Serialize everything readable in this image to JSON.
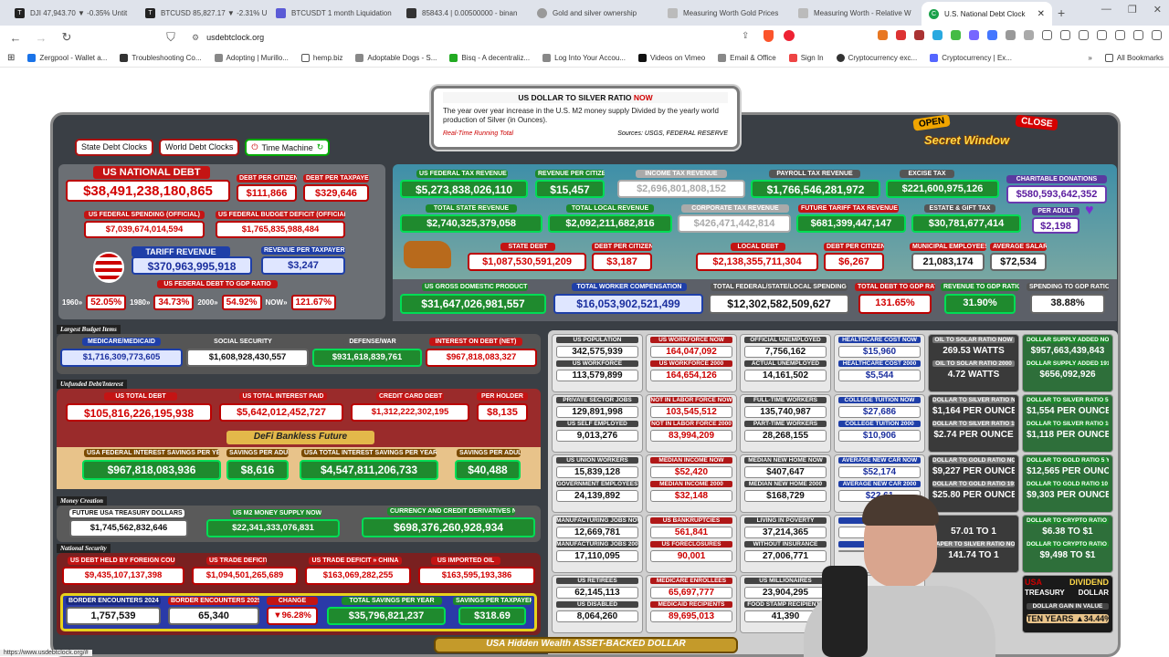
{
  "tabs": [
    {
      "label": "DJI 47,943.70 ▼ -0.35% Untit",
      "color": "#222"
    },
    {
      "label": "BTCUSD 85,827.17 ▼ -2.31% U",
      "color": "#222"
    },
    {
      "label": "BTCUSDT 1 month Liquidation",
      "color": "#5b5bd6"
    },
    {
      "label": "85843.4 | 0.00500000 - binan",
      "color": "#222"
    },
    {
      "label": "Gold and silver ownership",
      "color": "#888"
    },
    {
      "label": "Measuring Worth Gold Prices",
      "color": "#888"
    },
    {
      "label": "Measuring Worth - Relative W",
      "color": "#888"
    },
    {
      "label": "U.S. National Debt Clock",
      "color": "#1aa14a"
    }
  ],
  "address": "usdebtclock.org",
  "bookmarks": [
    "Zergpool - Wallet a...",
    "Troubleshooting Co...",
    "Adopting | Murillo...",
    "hemp.biz",
    "Adoptable Dogs - S...",
    "Bisq - A decentraliz...",
    "Log Into Your Accou...",
    "Videos on Vimeo",
    "Email & Office",
    "Sign In",
    "Cryptocurrency exc...",
    "Cryptocurrency | Ex...",
    "All Bookmarks"
  ],
  "notice": {
    "title_prefix": "US DOLLAR TO SILVER RATIO ",
    "title_now": "NOW",
    "desc": "The year over year increase in the U.S. M2 money supply Divided by the yearly world production of Silver (in Ounces).",
    "left": "Real-Time Running Total",
    "right": "Sources: USGS, FEDERAL RESERVE"
  },
  "secret": {
    "open": "OPEN",
    "close": "CLOSE",
    "title": "Secret Window"
  },
  "buttons": {
    "state": "State Debt Clocks",
    "world": "World Debt Clocks",
    "time": "Time Machine"
  },
  "left_top": {
    "debt_label": "US NATIONAL DEBT",
    "debt": "$38,491,238,180,865",
    "dpc_label": "DEBT PER CITIZEN",
    "dpc": "$111,866",
    "dpt_label": "DEBT PER TAXPAYER",
    "dpt": "$329,646",
    "spend_label": "US FEDERAL SPENDING (OFFICIAL)",
    "spend": "$7,039,674,014,594",
    "deficit_label": "US FEDERAL BUDGET DEFICIT (OFFICIAL)",
    "deficit": "$1,765,835,988,484",
    "tariff_label": "TARIFF REVENUE",
    "tariff": "$370,963,995,918",
    "rpt_label": "REVENUE PER TAXPAYER",
    "rpt": "$3,247",
    "gdp_label": "US FEDERAL DEBT TO GDP RATIO",
    "gdp": [
      {
        "y": "1960»",
        "v": "52.05%"
      },
      {
        "y": "1980»",
        "v": "34.73%"
      },
      {
        "y": "2000»",
        "v": "54.92%"
      },
      {
        "y": "NOW»",
        "v": "121.67%"
      }
    ]
  },
  "revenue": {
    "fed_label": "US FEDERAL TAX REVENUE",
    "fed": "$5,273,838,026,110",
    "rpc_label": "REVENUE PER CITIZEN",
    "rpc": "$15,457",
    "inc_label": "INCOME TAX REVENUE",
    "inc": "$2,696,801,808,152",
    "pay_label": "PAYROLL TAX REVENUE",
    "pay": "$1,766,546,281,972",
    "exc_label": "EXCISE TAX",
    "exc": "$221,600,975,126",
    "char_label": "CHARITABLE DONATIONS",
    "char": "$580,593,642,352",
    "st_label": "TOTAL STATE REVENUE",
    "st": "$2,740,325,379,058",
    "loc_label": "TOTAL LOCAL REVENUE",
    "loc": "$2,092,211,682,816",
    "corp_label": "CORPORATE TAX REVENUE",
    "corp": "$426,471,442,814",
    "ft_label": "FUTURE TARIFF TAX REVENUE",
    "ft": "$681,399,447,147",
    "est_label": "ESTATE & GIFT TAX",
    "est": "$30,781,677,414",
    "pa_label": "PER ADULT",
    "pa": "$2,198",
    "sd_label": "STATE DEBT",
    "sd": "$1,087,530,591,209",
    "sdpc_label": "DEBT PER CITIZEN",
    "sdpc": "$3,187",
    "ld_label": "LOCAL DEBT",
    "ld": "$2,138,355,711,304",
    "ldpc_label": "DEBT PER CITIZEN",
    "ldpc": "$6,267",
    "me_label": "MUNICIPAL EMPLOYEES",
    "me": "21,083,174",
    "as_label": "AVERAGE SALARY",
    "as": "$72,534",
    "gdp_label": "US GROSS DOMESTIC PRODUCT",
    "gdp": "$31,647,026,981,557",
    "twc_label": "TOTAL WORKER COMPENSATION",
    "twc": "$16,053,902,521,499",
    "tfd_label": "TOTAL FEDERAL/STATE/LOCAL SPENDING",
    "tfd": "$12,302,582,509,627",
    "tdg_label": "TOTAL DEBT TO GDP RATIO",
    "tdg": "131.65%",
    "rg_label": "REVENUE TO GDP RATIO",
    "rg": "31.90%",
    "sg_label": "SPENDING TO GDP RATIO",
    "sg": "38.88%"
  },
  "budget": {
    "section": "Largest Budget Items",
    "items": [
      {
        "label": "MEDICARE/MEDICAID",
        "value": "$1,716,309,773,605"
      },
      {
        "label": "SOCIAL SECURITY",
        "value": "$1,608,928,430,557"
      },
      {
        "label": "DEFENSE/WAR",
        "value": "$931,618,839,761"
      },
      {
        "label": "INTEREST ON DEBT (NET)",
        "value": "$967,818,083,327"
      }
    ]
  },
  "unfunded": {
    "section": "Unfunded Debt/Interest",
    "tot_label": "US TOTAL DEBT",
    "tot": "$105,816,226,195,938",
    "int_label": "US TOTAL INTEREST PAID",
    "int": "$5,642,012,452,727",
    "cc_label": "CREDIT CARD DEBT",
    "cc": "$1,312,222,302,195",
    "ph_label": "PER HOLDER",
    "ph": "$8,135",
    "defi": "DeFi Bankless Future",
    "fis_label": "USA FEDERAL INTEREST SAVINGS PER YEAR",
    "fis": "$967,818,083,936",
    "spa1_label": "SAVINGS PER ADULT",
    "spa1": "$8,616",
    "tis_label": "USA TOTAL INTEREST SAVINGS PER YEAR",
    "tis": "$4,547,811,206,733",
    "spa2_label": "SAVINGS PER ADULT",
    "spa2": "$40,488"
  },
  "money": {
    "section": "Money Creation",
    "tre_label": "FUTURE USA TREASURY DOLLARS",
    "tre": "$1,745,562,832,646",
    "m2_label": "US M2 MONEY SUPPLY NOW",
    "m2": "$22,341,333,076,831",
    "der_label": "CURRENCY AND CREDIT DERIVATIVES NOW",
    "der": "$698,376,260,928,934"
  },
  "security": {
    "section": "National Security",
    "for_label": "US DEBT HELD BY FOREIGN COUNTRIES",
    "for": "$9,435,107,137,398",
    "td_label": "US TRADE DEFICIT",
    "td": "$1,094,501,265,689",
    "tdc_label": "US TRADE DEFICIT » CHINA",
    "tdc": "$163,069,282,255",
    "oil_label": "US IMPORTED OIL",
    "oil": "$163,595,193,386",
    "b24_label": "BORDER ENCOUNTERS 2024",
    "b24": "1,757,539",
    "b25_label": "BORDER ENCOUNTERS 2025",
    "b25": "65,340",
    "chg_label": "CHANGE",
    "chg": "▼96.28%",
    "tsy_label": "TOTAL SAVINGS PER YEAR",
    "tsy": "$35,796,821,237",
    "spt_label": "SAVINGS PER TAXPAYER",
    "spt": "$318.69"
  },
  "grid": {
    "col1": [
      {
        "l1": "US POPULATION",
        "v1": "342,575,939",
        "l2": "US WORKFORCE",
        "v2": "113,579,899"
      },
      {
        "l1": "PRIVATE SECTOR JOBS",
        "v1": "129,891,998",
        "l2": "US SELF EMPLOYED",
        "v2": "9,013,276"
      },
      {
        "l1": "US UNION WORKERS",
        "v1": "15,839,128",
        "l2": "GOVERNMENT EMPLOYEES",
        "v2": "24,139,892"
      },
      {
        "l1": "MANUFACTURING JOBS NOW",
        "v1": "12,669,781",
        "l2": "MANUFACTURING JOBS 2000",
        "v2": "17,110,095"
      },
      {
        "l1": "US RETIREES",
        "v1": "62,145,113",
        "l2": "US DISABLED",
        "v2": "8,064,260"
      }
    ],
    "col2": [
      {
        "l1": "US WORKFORCE NOW",
        "v1": "164,047,092",
        "l2": "US WORKFORCE 2000",
        "v2": "164,654,126"
      },
      {
        "l1": "NOT IN LABOR FORCE NOW",
        "v1": "103,545,512",
        "l2": "NOT IN LABOR FORCE 2000",
        "v2": "83,994,209"
      },
      {
        "l1": "MEDIAN INCOME NOW",
        "v1": "$52,420",
        "l2": "MEDIAN INCOME 2000",
        "v2": "$32,148"
      },
      {
        "l1": "US BANKRUPTCIES",
        "v1": "561,841",
        "l2": "US FORECLOSURES",
        "v2": "90,001"
      },
      {
        "l1": "MEDICARE ENROLLEES",
        "v1": "65,697,777",
        "l2": "MEDICAID RECIPIENTS",
        "v2": "89,695,013"
      }
    ],
    "col3": [
      {
        "l1": "OFFICIAL UNEMPLOYED",
        "v1": "7,756,162",
        "l2": "ACTUAL UNEMPLOYED",
        "v2": "14,161,502"
      },
      {
        "l1": "FULL-TIME WORKERS",
        "v1": "135,740,987",
        "l2": "PART-TIME WORKERS",
        "v2": "28,268,155"
      },
      {
        "l1": "MEDIAN NEW HOME NOW",
        "v1": "$407,647",
        "l2": "MEDIAN NEW HOME 2000",
        "v2": "$168,729"
      },
      {
        "l1": "LIVING IN POVERTY",
        "v1": "37,214,365",
        "l2": "WITHOUT INSURANCE",
        "v2": "27,006,771"
      },
      {
        "l1": "US MILLIONAIRES",
        "v1": "23,904,295",
        "l2": "FOOD STAMP RECIPIENTS",
        "v2": "41,390"
      }
    ],
    "col4": [
      {
        "l1": "HEALTHCARE COST NOW",
        "v1": "$15,960",
        "l2": "HEALTHCARE COST 2000",
        "v2": "$5,544"
      },
      {
        "l1": "COLLEGE TUITION NOW",
        "v1": "$27,686",
        "l2": "COLLEGE TUITION 2000",
        "v2": "$10,906"
      },
      {
        "l1": "AVERAGE NEW CAR NOW",
        "v1": "$52,174",
        "l2": "AVERAGE NEW CAR 2000",
        "v2": "$22,61"
      },
      {
        "l1": "US HO",
        "v1": "735",
        "l2": "US",
        "v2": ""
      },
      {
        "l1": "",
        "v1": "",
        "l2": "",
        "v2": ""
      }
    ],
    "col5": [
      {
        "l1": "OIL TO SOLAR RATIO NOW",
        "v1": "269.53 WATTS",
        "l2": "OIL TO SOLAR RATIO 2000",
        "v2": "4.72 WATTS"
      },
      {
        "l1": "DOLLAR TO SILVER RATIO NOW",
        "v1": "$1,164 PER OUNCE",
        "l2": "DOLLAR TO SILVER RATIO 1913",
        "v2": "$2.74 PER OUNCE"
      },
      {
        "l1": "DOLLAR TO GOLD RATIO NOW",
        "v1": "$9,227 PER OUNCE",
        "l2": "DOLLAR TO GOLD RATIO 1913",
        "v2": "$25.80 PER OUNCE"
      },
      {
        "l1": "",
        "v1": "57.01 TO 1",
        "l2": "PAPER TO SILVER RATIO NOW",
        "v2": "141.74 TO 1"
      }
    ],
    "col6": [
      {
        "l1": "DOLLAR SUPPLY ADDED NOW",
        "v1": "$957,663,439,843",
        "l2": "DOLLAR SUPPLY ADDED 1913",
        "v2": "$656,092,926"
      },
      {
        "l1": "DOLLAR TO SILVER RATIO 5 YR",
        "v1": "$1,554 PER OUNCE",
        "l2": "DOLLAR TO SILVER RATIO 10 YR",
        "v2": "$1,118 PER OUNCE"
      },
      {
        "l1": "DOLLAR TO GOLD RATIO 5 YR",
        "v1": "$12,565 PER OUNCE",
        "l2": "DOLLAR TO GOLD RATIO 10 YR",
        "v2": "$9,303 PER OUNCE"
      },
      {
        "l1": "DOLLAR TO CRYPTO RATIO NOW",
        "v1": "$6.38 TO $1",
        "l2": "DOLLAR TO CRYPTO RATIO 2013",
        "v2": "$9,498 TO $1"
      }
    ],
    "dividend": {
      "t1": "USA",
      "t2": "TREASURY",
      "t3": "DIVIDEND",
      "t4": "DOLLAR",
      "gain_label": "DOLLAR GAIN IN VALUE",
      "gain": "TEN YEARS ▲34.44%"
    }
  },
  "bottom": "USA Hidden Wealth   ASSET-BACKED DOLLAR",
  "status_url": "https://www.usdebtclock.org/#"
}
